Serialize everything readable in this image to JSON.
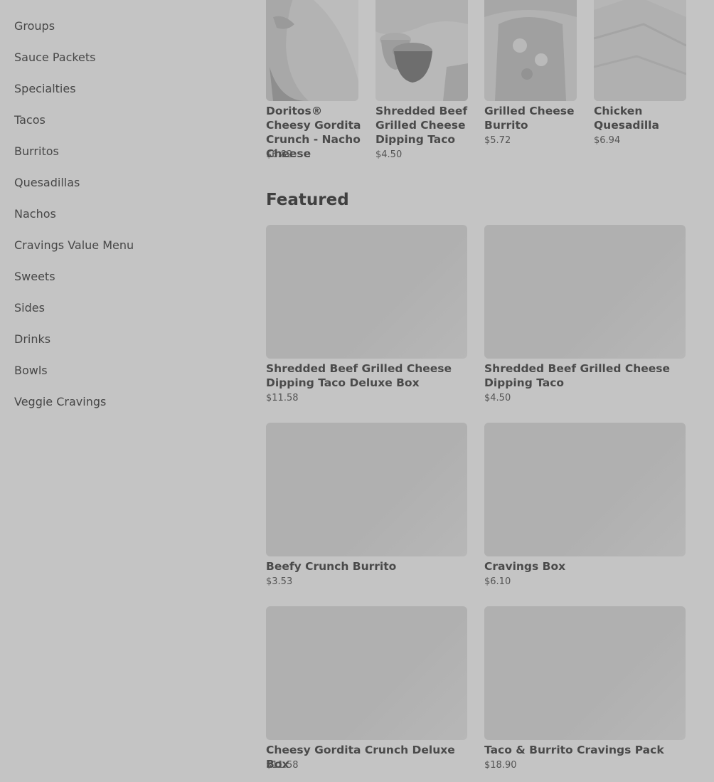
{
  "sidebar": {
    "items": [
      {
        "label": "Groups"
      },
      {
        "label": "Sauce Packets"
      },
      {
        "label": "Specialties"
      },
      {
        "label": "Tacos"
      },
      {
        "label": "Burritos"
      },
      {
        "label": "Quesadillas"
      },
      {
        "label": "Nachos"
      },
      {
        "label": "Cravings Value Menu"
      },
      {
        "label": "Sweets"
      },
      {
        "label": "Sides"
      },
      {
        "label": "Drinks"
      },
      {
        "label": "Bowls"
      },
      {
        "label": "Veggie Cravings"
      }
    ]
  },
  "top_items": [
    {
      "name": "Doritos® Cheesy Gordita Crunch - Nacho Cheese",
      "price": "$6.82"
    },
    {
      "name": "Shredded Beef Grilled Cheese Dipping Taco",
      "price": "$4.50"
    },
    {
      "name": "Grilled Cheese Burrito",
      "price": "$5.72"
    },
    {
      "name": "Chicken Quesadilla",
      "price": "$6.94"
    }
  ],
  "featured": {
    "title": "Featured",
    "items": [
      {
        "name": "Shredded Beef Grilled Cheese Dipping Taco Deluxe Box",
        "price": "$11.58"
      },
      {
        "name": "Shredded Beef Grilled Cheese Dipping Taco",
        "price": "$4.50"
      },
      {
        "name": "Beefy Crunch Burrito",
        "price": "$3.53"
      },
      {
        "name": "Cravings Box",
        "price": "$6.10"
      },
      {
        "name": "Cheesy Gordita Crunch Deluxe Box",
        "price": "$11.58"
      },
      {
        "name": "Taco & Burrito Cravings Pack",
        "price": "$18.90"
      }
    ]
  }
}
